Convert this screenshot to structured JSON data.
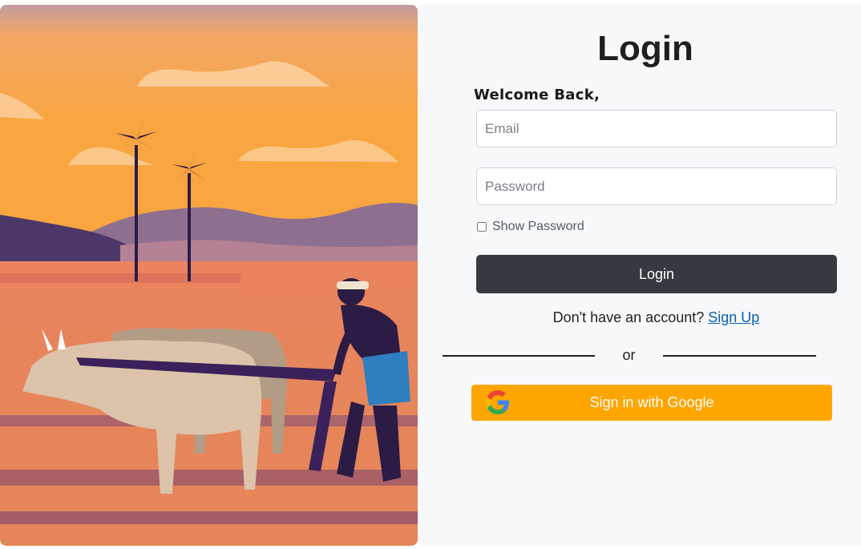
{
  "illustration": {
    "icon": "farmer-plowing-with-oxen-illustration"
  },
  "login": {
    "title": "Login",
    "welcome": "Welcome Back,",
    "email_placeholder": "Email",
    "password_placeholder": "Password",
    "show_password_label": "Show Password",
    "show_password_checked": false,
    "submit_label": "Login",
    "signup_prompt": "Don't have an account?",
    "signup_link": "Sign Up",
    "divider_text": "or",
    "google_label": "Sign in with Google",
    "google_icon": "google-g-icon"
  },
  "colors": {
    "submit_bg": "#343a40",
    "google_bg": "#ffa500",
    "link": "#0b5db8",
    "panel_bg": "#f7f8fa"
  }
}
